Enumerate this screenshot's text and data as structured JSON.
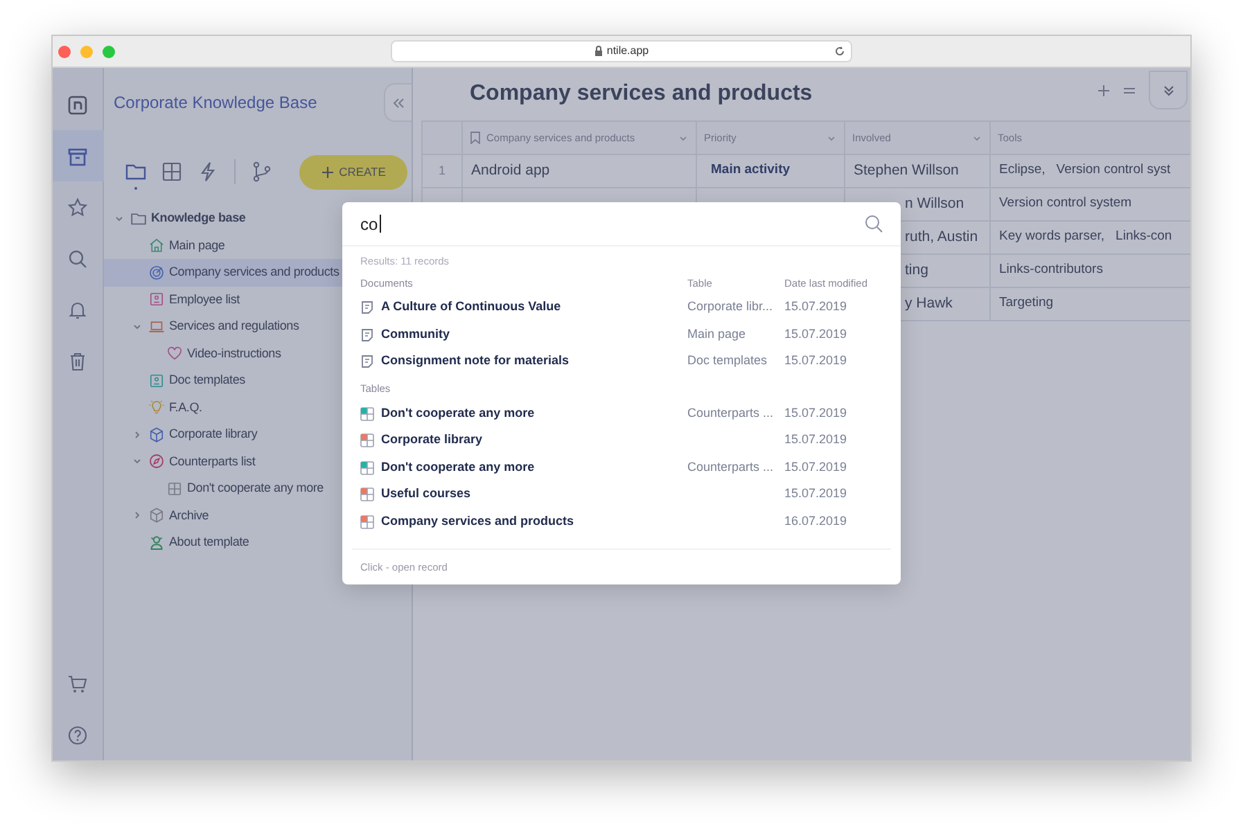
{
  "browser": {
    "url": "ntile.app"
  },
  "rail": [
    {
      "selected": false
    },
    {
      "selected": true
    },
    {
      "selected": false
    },
    {
      "selected": false
    },
    {
      "selected": false
    },
    {
      "selected": false
    },
    {
      "selected": false
    },
    {
      "selected": false
    }
  ],
  "sidebar": {
    "title": "Corporate Knowledge Base",
    "tabs": [
      {
        "selected": true
      },
      {
        "selected": false
      },
      {
        "selected": false
      },
      {
        "selected": false
      }
    ],
    "create_button": "CREATE",
    "tree": [
      {
        "label": "Knowledge base",
        "expanded": true,
        "selected": false,
        "children": [
          {
            "label": "Main page",
            "selected": false
          },
          {
            "label": "Company services and products",
            "selected": true
          },
          {
            "label": "Employee list",
            "selected": false
          },
          {
            "label": "Services and regulations",
            "expanded": true,
            "selected": false,
            "children": [
              {
                "label": "Video-instructions",
                "selected": false
              }
            ]
          },
          {
            "label": "Doc templates",
            "selected": false
          },
          {
            "label": "F.A.Q.",
            "selected": false
          },
          {
            "label": "Corporate library",
            "expanded": false,
            "selected": false
          },
          {
            "label": "Counterparts list",
            "expanded": true,
            "selected": false,
            "children": [
              {
                "label": "Don't cooperate any more",
                "selected": false
              }
            ]
          },
          {
            "label": "Archive",
            "expanded": false,
            "selected": false
          },
          {
            "label": "About template",
            "selected": false
          }
        ]
      }
    ]
  },
  "main": {
    "title": "Company services and products",
    "table": {
      "columns": [
        "Company services and products",
        "Priority",
        "Involved",
        "Tools"
      ],
      "rows": [
        {
          "index": "1",
          "name": "Android app",
          "priority": "Main activity",
          "involved": "Stephen Willson",
          "tools": [
            "Eclipse,",
            "Version control syst"
          ]
        },
        {
          "involved": "n Willson",
          "tools": [
            "Version control system"
          ]
        },
        {
          "involved": "ruth,   Austin",
          "tools": [
            "Key words parser,",
            "Links-con"
          ]
        },
        {
          "involved": "ting",
          "tools": [
            "Links-contributors"
          ]
        },
        {
          "involved": "y Hawk",
          "tools": [
            "Targeting"
          ]
        }
      ]
    }
  },
  "search": {
    "value": "co",
    "results_count": "Results: 11 records",
    "columns": [
      "Table",
      "Date last modified"
    ],
    "sections": [
      {
        "title": "Documents",
        "kind": "document",
        "items": [
          {
            "name": "A Culture of Continuous Value",
            "table": "Corporate libr...",
            "date": "15.07.2019"
          },
          {
            "name": "Community",
            "table": "Main page",
            "date": "15.07.2019"
          },
          {
            "name": "Consignment note for materials",
            "table": "Doc templates",
            "date": "15.07.2019"
          }
        ]
      },
      {
        "title": "Tables",
        "kind": "table",
        "items": [
          {
            "name": "Don't cooperate any more",
            "table": "Counterparts ...",
            "date": "15.07.2019",
            "color": "#1fb5a6"
          },
          {
            "name": "Corporate library",
            "date": "15.07.2019",
            "color": "#f07860"
          },
          {
            "name": "Don't cooperate any more",
            "table": "Counterparts ...",
            "date": "15.07.2019",
            "color": "#1fb5a6"
          },
          {
            "name": "Useful courses",
            "date": "15.07.2019",
            "color": "#f07860"
          },
          {
            "name": "Company services and products",
            "date": "16.07.2019",
            "color": "#f07860"
          }
        ]
      }
    ],
    "footer": "Click - open record"
  }
}
